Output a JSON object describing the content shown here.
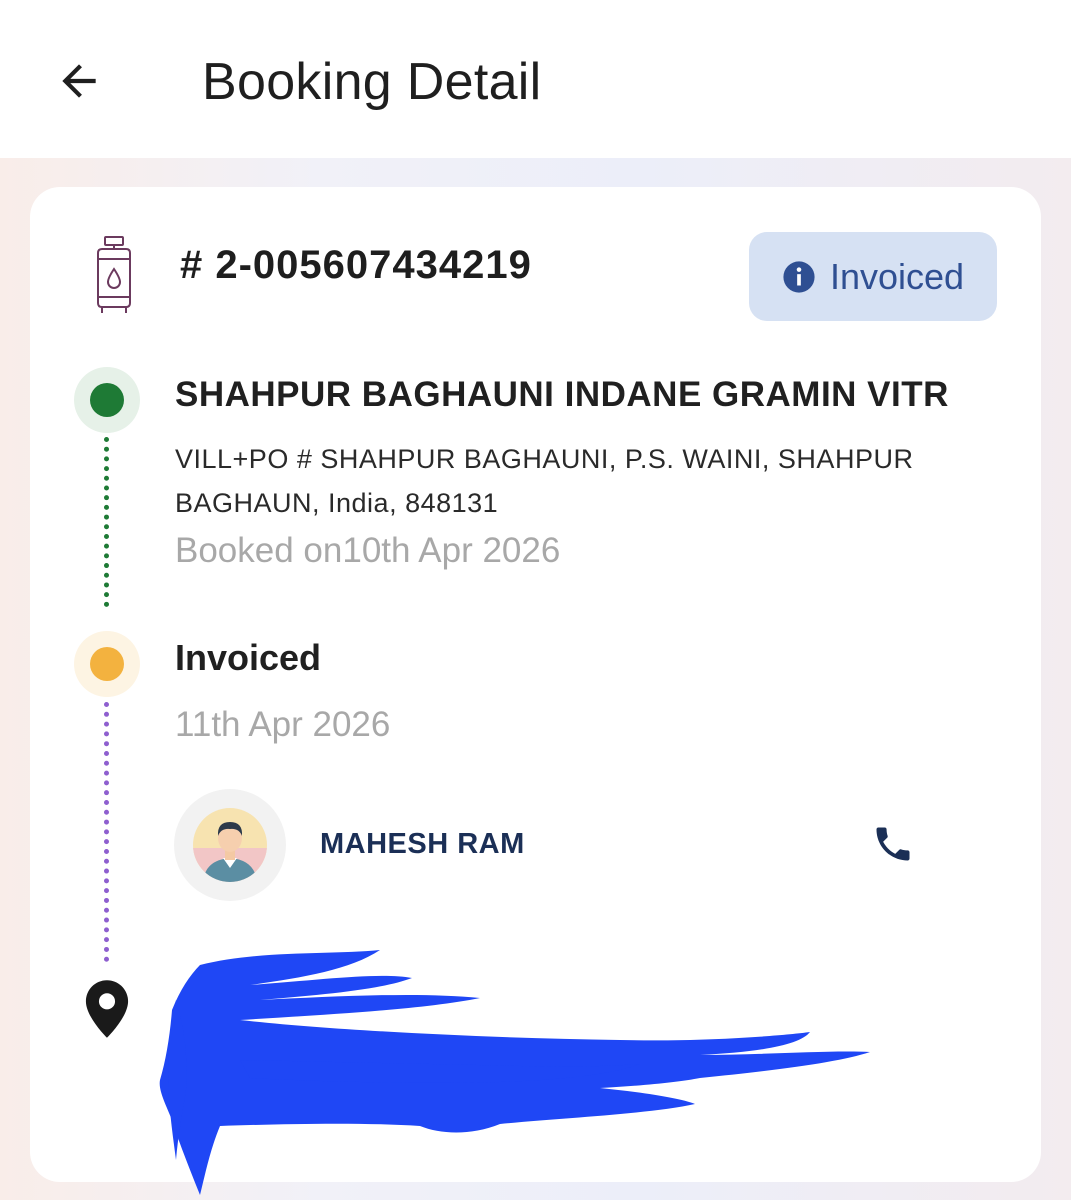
{
  "header": {
    "title": "Booking Detail",
    "back_icon": "arrow-left-icon"
  },
  "booking": {
    "id": "# 2-005607434219",
    "status": "Invoiced",
    "status_icon": "info-icon"
  },
  "distributor": {
    "name": "SHAHPUR BAGHAUNI INDANE GRAMIN VITR",
    "address": "VILL+PO # SHAHPUR BAGHAUNI, P.S. WAINI, SHAHPUR BAGHAUN, India, 848131",
    "booked_on": "Booked on10th Apr 2026"
  },
  "invoice": {
    "title": "Invoiced",
    "date": "11th Apr 2026"
  },
  "driver": {
    "name": "MAHESH RAM",
    "call_icon": "phone-icon"
  },
  "colors": {
    "green_dot": "#1e7a35",
    "orange_dot": "#f3b23f",
    "purple_line": "#8e5fcf",
    "badge_bg": "#d6e1f3",
    "badge_text": "#2f4f92",
    "redaction": "#1f47f5"
  }
}
